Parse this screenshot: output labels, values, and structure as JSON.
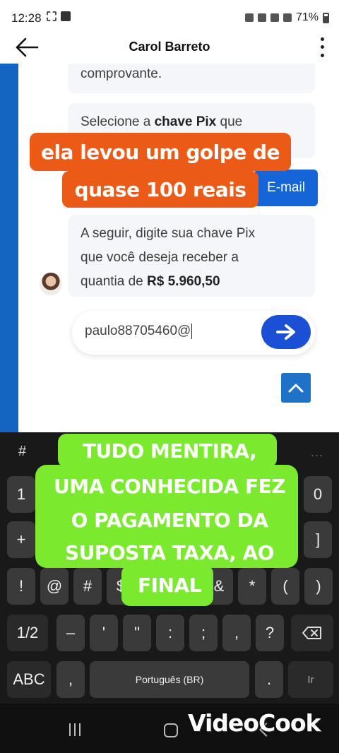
{
  "status_bar": {
    "time": "12:28",
    "battery": "71%"
  },
  "header": {
    "title": "Carol Barreto"
  },
  "chat": {
    "msg1": "comprovante.",
    "msg2_pre": "Selecione a ",
    "msg2_bold": "chave Pix",
    "msg2_post": " que",
    "email_button": "E-mail",
    "msg3_line1": "A seguir, digite sua chave Pix",
    "msg3_line2": "que você deseja receber a",
    "msg3_pre": "quantia de ",
    "msg3_bold": "R$ 5.960,50",
    "input_value": "paulo88705460@"
  },
  "captions": {
    "orange_line1": "ela levou um golpe de",
    "orange_line2": "quase 100 reais",
    "green_lines": [
      "TUDO  MENTIRA,",
      "UMA CONHECIDA FEZ",
      "O PAGAMENTO DA",
      "SUPOSTA TAXA, AO",
      "FINAL"
    ]
  },
  "keyboard": {
    "top_left": "#",
    "top_right": "...",
    "row1_left": "1",
    "row1_right": "0",
    "row2_left": "+",
    "row2_right": "]",
    "row3": [
      "!",
      "@",
      "#",
      "$",
      "&",
      "*",
      "(",
      ")"
    ],
    "row4": [
      "1/2",
      "–",
      "'",
      "\"",
      ":",
      ";",
      ",",
      "?"
    ],
    "abc": "ABC",
    "comma": ",",
    "space": "Português (BR)",
    "period": ".",
    "enter": "Ir"
  },
  "watermark": "VideoCook"
}
